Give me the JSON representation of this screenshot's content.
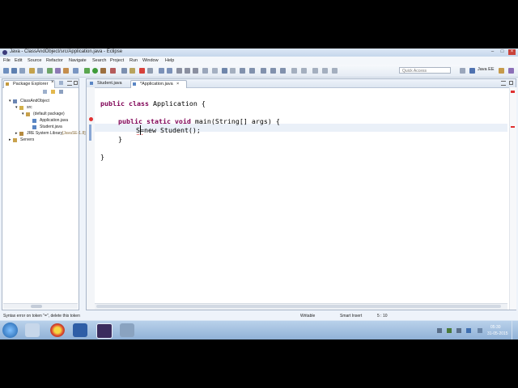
{
  "window": {
    "title": "Java - ClassAndObject/src/Application.java - Eclipse",
    "min": "–",
    "max": "□",
    "close": "×"
  },
  "menu": [
    "File",
    "Edit",
    "Source",
    "Refactor",
    "Navigate",
    "Search",
    "Project",
    "Run",
    "Window",
    "Help"
  ],
  "toolbar": {
    "quick_access_placeholder": "Quick Access",
    "perspective": "Java EE"
  },
  "package_explorer": {
    "tabs": [
      "Package Explorer",
      "Servers"
    ],
    "tree": [
      {
        "label": "ClassAndObject",
        "icon": "project-icon"
      },
      {
        "label": "src",
        "icon": "source-folder-icon"
      },
      {
        "label": "(default package)",
        "icon": "package-icon"
      },
      {
        "label": "Application.java",
        "icon": "java-file-icon"
      },
      {
        "label": "Student.java",
        "icon": "java-file-icon"
      },
      {
        "label": "JRE System Library",
        "suffix": "[JavaSE-1.8]",
        "icon": "library-icon"
      },
      {
        "label": "Servers",
        "icon": "folder-icon"
      }
    ]
  },
  "editor": {
    "tabs": [
      "Student.java",
      "*Application.java"
    ],
    "code": {
      "l1_kw": "public class",
      "l1_rest": " Application {",
      "l3_kw": "public static void",
      "l3_rest": " main(String[] args) {",
      "l4_text": "S=new Student();",
      "l5": "}",
      "l7": "}"
    }
  },
  "status": {
    "error": "Syntax error on token \"=\", delete this token",
    "writable": "Writable",
    "insert": "Smart Insert",
    "position": "5 : 10"
  },
  "taskbar": {
    "time": "05:30",
    "date": "31-05-2015"
  },
  "colors": {
    "keyword": "#7f0055",
    "error": "#e03030",
    "accent": "#1c5fa8"
  }
}
